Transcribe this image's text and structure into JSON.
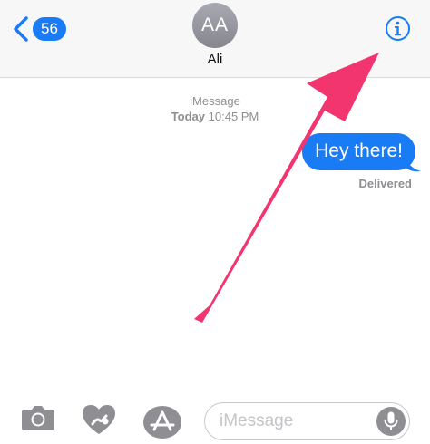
{
  "header": {
    "unread_count": "56",
    "avatar_initials": "AA",
    "contact_name": "Ali"
  },
  "conversation": {
    "service_label": "iMessage",
    "timestamp_day": "Today",
    "timestamp_time": "10:45 PM",
    "messages": [
      {
        "text": "Hey there!",
        "sender": "me",
        "status": "Delivered"
      }
    ]
  },
  "composer": {
    "placeholder": "iMessage"
  },
  "colors": {
    "accent": "#1a7cf5",
    "annotation_arrow": "#f2346f",
    "muted_text": "#8e8e93"
  },
  "icons": {
    "back": "chevron-left-icon",
    "info": "info-circle-icon",
    "camera": "camera-icon",
    "digital_touch": "digital-touch-heart-icon",
    "app_store": "app-store-icon",
    "microphone": "microphone-icon"
  }
}
